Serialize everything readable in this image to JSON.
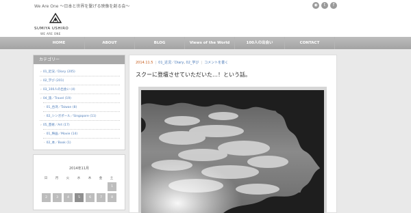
{
  "site": {
    "tagline": "We Are One 〜日本と世界を繋げる映像を創る会〜",
    "logo_name": "SUMIYA USHIRO",
    "logo_sub": "WE ARE ONE"
  },
  "social_icons": [
    "rss-icon",
    "twitter-icon",
    "facebook-icon"
  ],
  "nav": {
    "items": [
      {
        "label": "HOME"
      },
      {
        "label": "ABOUT"
      },
      {
        "label": "BLOG"
      },
      {
        "label": "Views of the World"
      },
      {
        "label": "100人の出会い"
      },
      {
        "label": "CONTACT"
      }
    ]
  },
  "sidebar": {
    "categories_title": "カテゴリー",
    "categories": [
      {
        "label": "01_近況／Diary (205)",
        "indent": 0
      },
      {
        "label": "02_学び (201)",
        "indent": 0
      },
      {
        "label": "03_100人の出会い (4)",
        "indent": 0
      },
      {
        "label": "04_旅／Travel (19)",
        "indent": 0
      },
      {
        "label": "01_台湾／Taiwan (8)",
        "indent": 1
      },
      {
        "label": "02_シンガポール／Singapore (11)",
        "indent": 1
      },
      {
        "label": "05_芸術／Art (17)",
        "indent": 0
      },
      {
        "label": "01_映画／Movie (14)",
        "indent": 1
      },
      {
        "label": "02_本／Book (1)",
        "indent": 1
      }
    ],
    "calendar": {
      "title": "2014年11月",
      "weekdays": [
        "日",
        "月",
        "火",
        "水",
        "木",
        "金",
        "土"
      ],
      "days": [
        "1",
        "2",
        "3",
        "4",
        "5",
        "6",
        "7",
        "8"
      ]
    }
  },
  "post": {
    "date": "2014.11.5",
    "categories": [
      "01_近況／Diary",
      "02_学び"
    ],
    "comment_link": "コメントを書く",
    "title": "スクーに登壇させていただいた…！という話。"
  },
  "colors": {
    "nav_bg": "#a9a9a9",
    "accent_link": "#4a7ab8",
    "date": "#c55a1a",
    "page_bg": "#e9e9e9"
  }
}
